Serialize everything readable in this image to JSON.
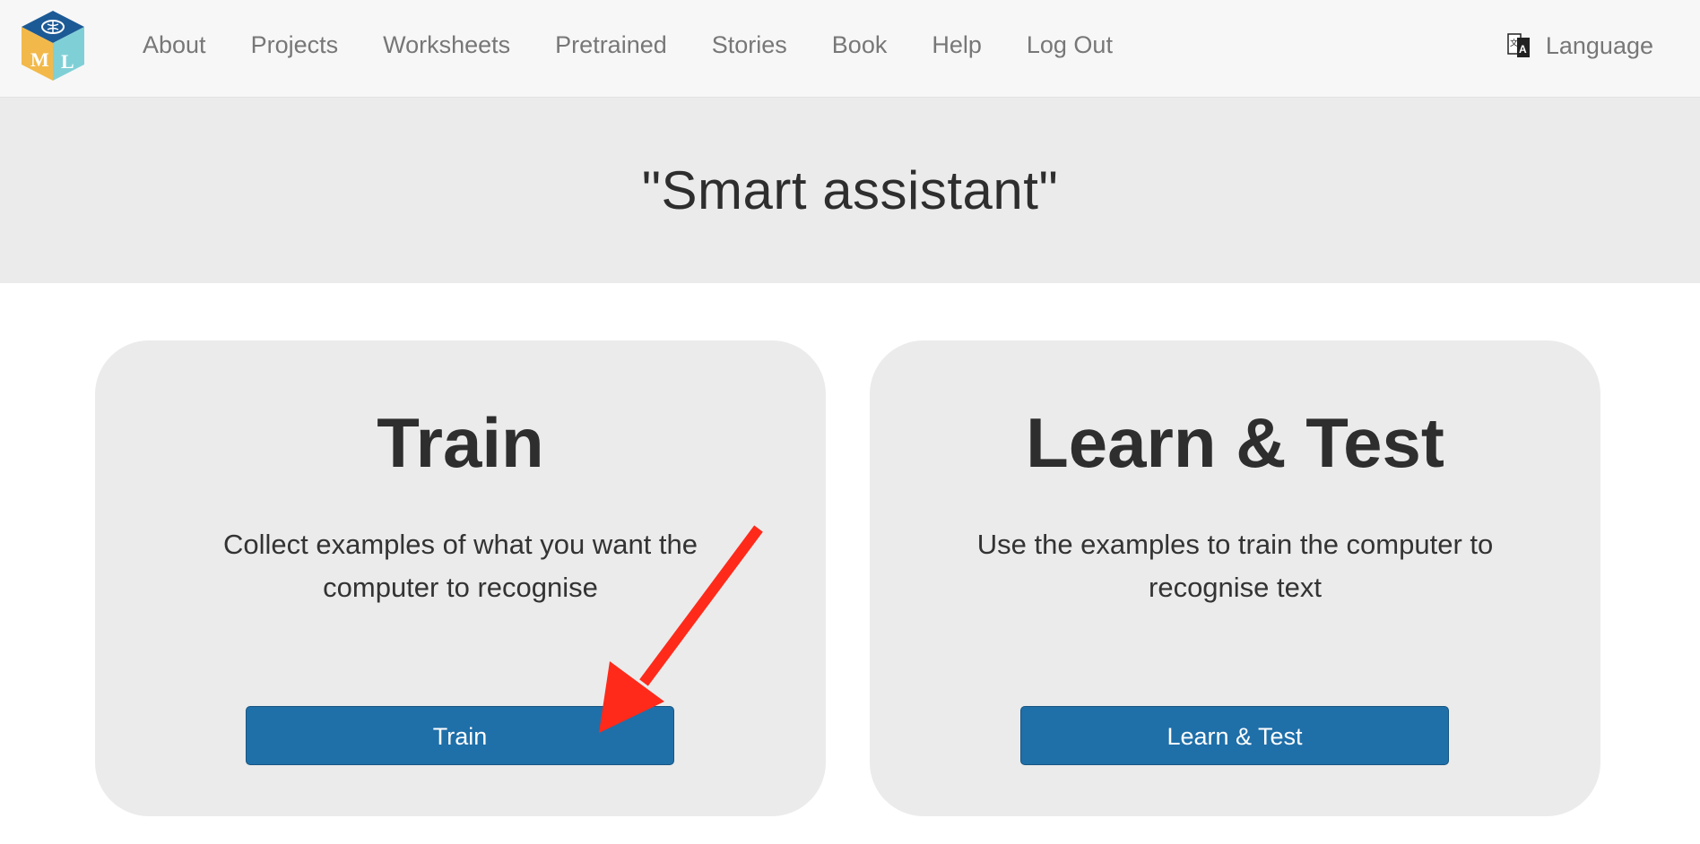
{
  "navbar": {
    "logo_letters": [
      "M",
      "L"
    ],
    "items": [
      {
        "label": "About"
      },
      {
        "label": "Projects"
      },
      {
        "label": "Worksheets"
      },
      {
        "label": "Pretrained"
      },
      {
        "label": "Stories"
      },
      {
        "label": "Book"
      },
      {
        "label": "Help"
      },
      {
        "label": "Log Out"
      }
    ],
    "language": {
      "label": "Language",
      "icon": "translate-icon"
    }
  },
  "header": {
    "title": "\"Smart assistant\""
  },
  "cards": [
    {
      "heading": "Train",
      "description": "Collect examples of what you want the computer to recognise",
      "button_label": "Train"
    },
    {
      "heading": "Learn & Test",
      "description": "Use the examples to train the computer to recognise text",
      "button_label": "Learn & Test"
    }
  ],
  "colors": {
    "button": "#1f6fa9",
    "card_bg": "#ebebeb",
    "navbar_bg": "#f7f7f7",
    "annotation_arrow": "#ff2a1a"
  }
}
